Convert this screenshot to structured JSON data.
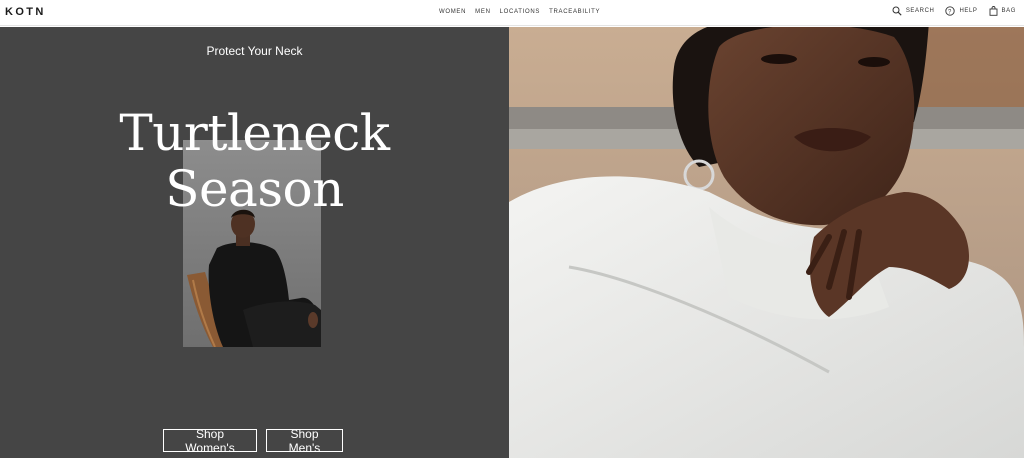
{
  "brand": {
    "logo": "KOTN"
  },
  "nav": {
    "items": [
      {
        "label": "WOMEN"
      },
      {
        "label": "MEN"
      },
      {
        "label": "LOCATIONS"
      },
      {
        "label": "TRACEABILITY"
      }
    ]
  },
  "utilities": {
    "search": {
      "label": "SEARCH",
      "icon": "search-icon"
    },
    "help": {
      "label": "HELP",
      "icon": "help-icon"
    },
    "bag": {
      "label": "BAG",
      "icon": "bag-icon"
    }
  },
  "hero": {
    "eyebrow": "Protect Your Neck",
    "headline_line1": "Turtleneck",
    "headline_line2": "Season",
    "cta_women": "Shop Women's",
    "cta_men": "Shop Men's"
  },
  "colors": {
    "panel_bg": "#454545",
    "header_bg": "#ffffff",
    "text_light": "#ffffff"
  }
}
